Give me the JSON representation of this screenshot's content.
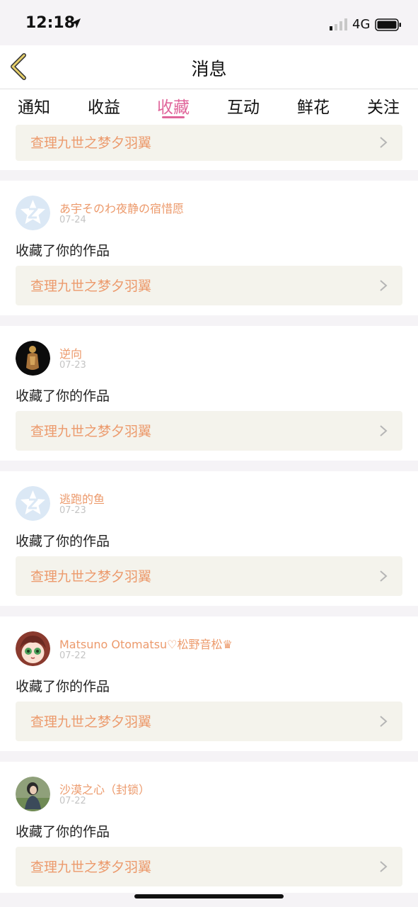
{
  "status_bar": {
    "time": "12:18",
    "network": "4G"
  },
  "nav": {
    "title": "消息"
  },
  "tabs": [
    {
      "label": "通知",
      "active": false
    },
    {
      "label": "收益",
      "active": false
    },
    {
      "label": "收藏",
      "active": true
    },
    {
      "label": "互动",
      "active": false
    },
    {
      "label": "鲜花",
      "active": false
    },
    {
      "label": "关注",
      "active": false
    }
  ],
  "colors": {
    "accent": "#e0669b",
    "username": "#ec9a6c",
    "work_bg": "#f4f3ec"
  },
  "partial_item": {
    "work_title": "查理九世之梦夕羽翼"
  },
  "items": [
    {
      "username": "あ宇そのわ夜静の宿惜愿",
      "date": "07-24",
      "action": "收藏了你的作品",
      "work_title": "查理九世之梦夕羽翼",
      "avatar": "default-avatar-icon"
    },
    {
      "username": "逆向",
      "date": "07-23",
      "action": "收藏了你的作品",
      "work_title": "查理九世之梦夕羽翼",
      "avatar": "user-avatar"
    },
    {
      "username": "逃跑的鱼",
      "date": "07-23",
      "action": "收藏了你的作品",
      "work_title": "查理九世之梦夕羽翼",
      "avatar": "default-avatar-icon"
    },
    {
      "username": "Matsuno Otomatsu♡松野音松♛",
      "date": "07-22",
      "action": "收藏了你的作品",
      "work_title": "查理九世之梦夕羽翼",
      "avatar": "anime-avatar"
    },
    {
      "username": "沙漠之心（封锁）",
      "date": "07-22",
      "action": "收藏了你的作品",
      "work_title": "查理九世之梦夕羽翼",
      "avatar": "photo-avatar"
    }
  ]
}
